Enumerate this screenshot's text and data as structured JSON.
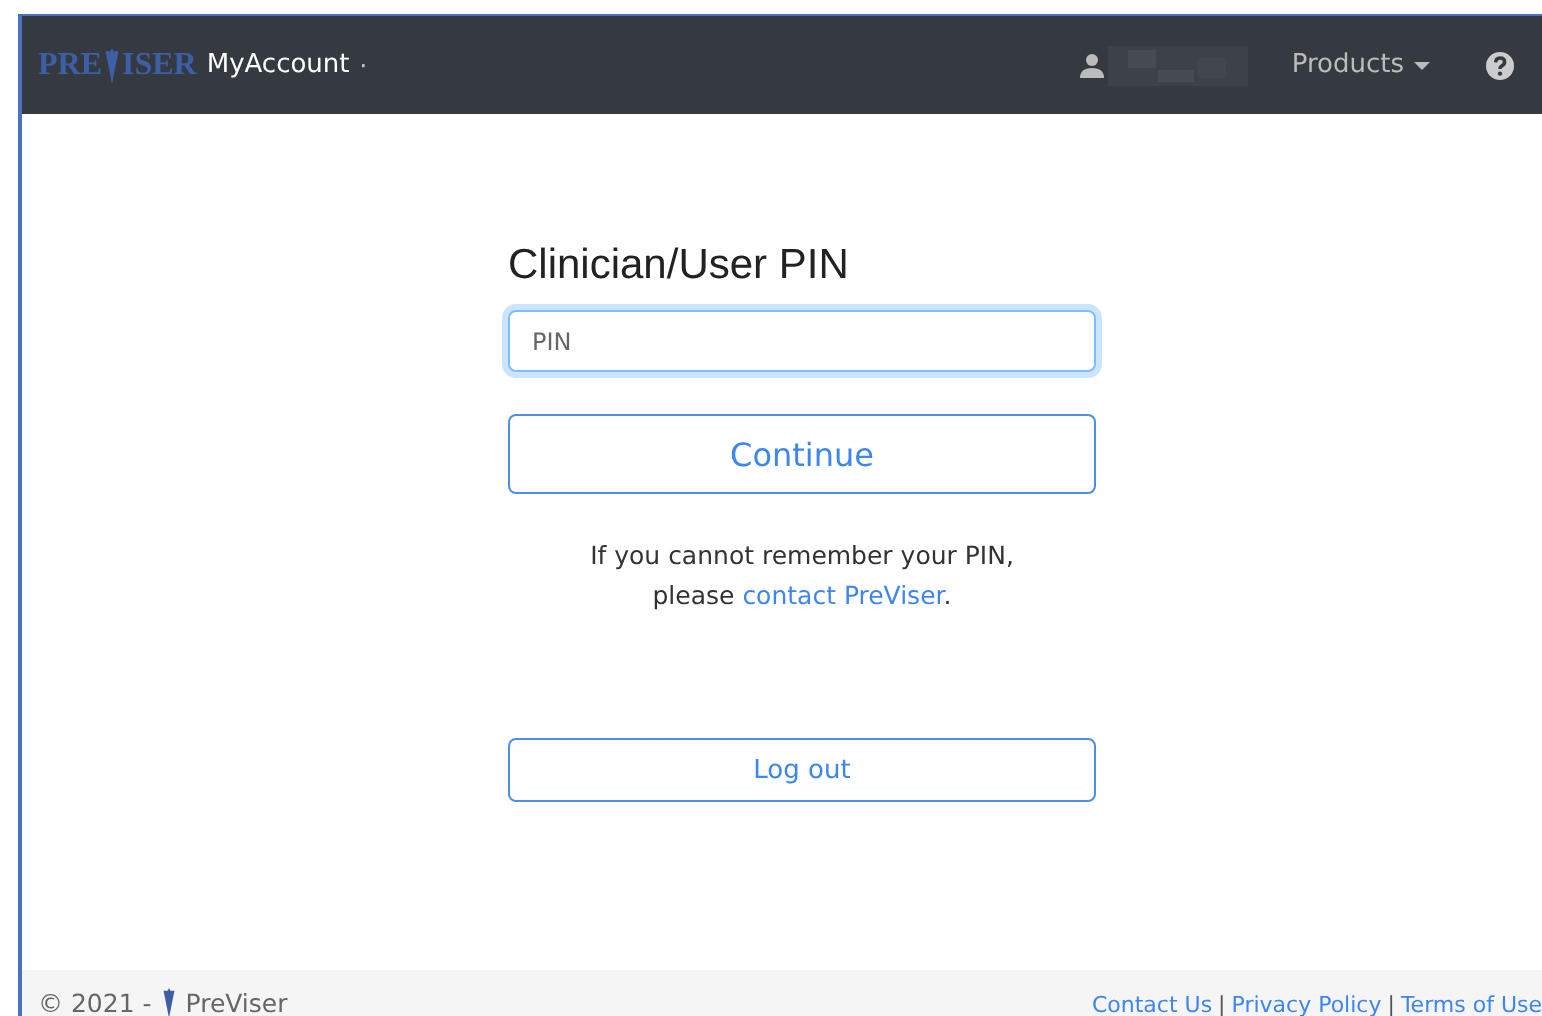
{
  "navbar": {
    "logo_left": "PRE",
    "logo_right": "ISER",
    "app_name": "MyAccount",
    "separator": "·",
    "products_menu": "Products"
  },
  "form": {
    "title": "Clinician/User PIN",
    "pin_field": {
      "placeholder": "PIN"
    },
    "continue_button": "Continue",
    "help_line_1": "If you cannot remember your PIN,",
    "help_prefix": "please ",
    "help_link": "contact PreViser",
    "help_suffix": ".",
    "logout_button": "Log out"
  },
  "footer": {
    "copyright": "© 2021 -",
    "brand": "PreViser",
    "links": [
      "Contact Us",
      "Privacy Policy",
      "Terms of Use"
    ],
    "link_separators": [
      "|",
      "|"
    ]
  }
}
